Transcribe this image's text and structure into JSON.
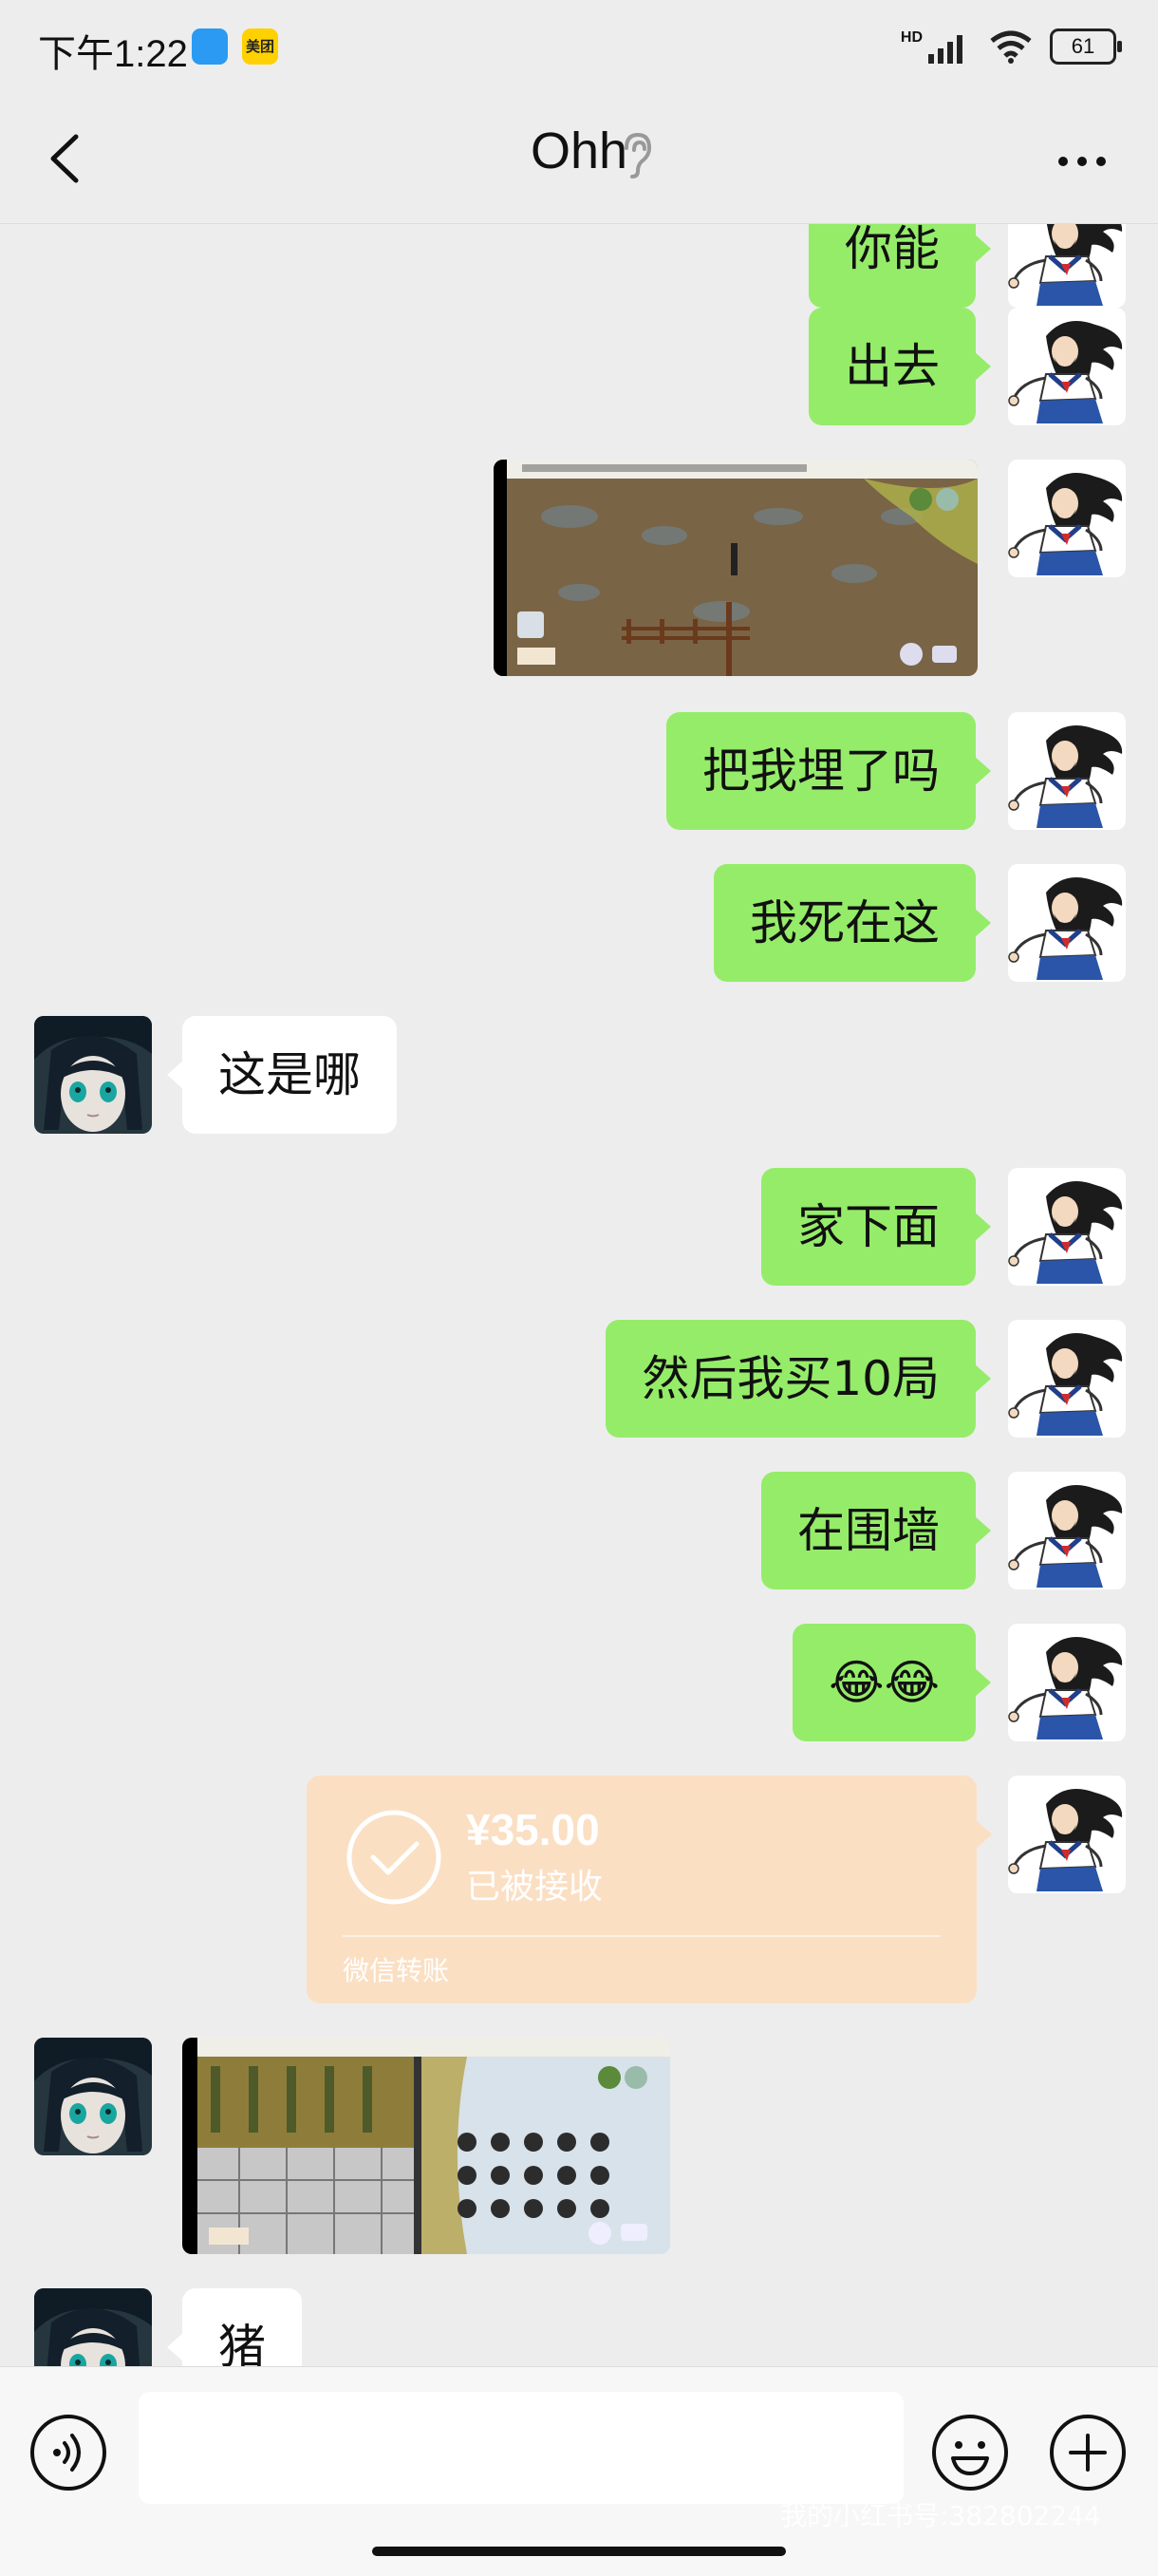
{
  "status_bar": {
    "time": "下午1:22",
    "meituan_badge": "美团",
    "network": "HD",
    "battery": "61"
  },
  "header": {
    "title": "Ohh"
  },
  "messages": [
    {
      "side": "right",
      "type": "text",
      "text": "你能"
    },
    {
      "side": "right",
      "type": "text",
      "text": "出去"
    },
    {
      "side": "right",
      "type": "image"
    },
    {
      "side": "right",
      "type": "text",
      "text": "把我埋了吗"
    },
    {
      "side": "right",
      "type": "text",
      "text": "我死在这"
    },
    {
      "side": "left",
      "type": "text",
      "text": "这是哪"
    },
    {
      "side": "right",
      "type": "text",
      "text": "家下面"
    },
    {
      "side": "right",
      "type": "text",
      "text": "然后我买10局"
    },
    {
      "side": "right",
      "type": "text",
      "text": "在围墙"
    },
    {
      "side": "right",
      "type": "text",
      "text": "😂😂"
    },
    {
      "side": "right",
      "type": "transfer"
    },
    {
      "side": "left",
      "type": "image"
    },
    {
      "side": "left",
      "type": "text",
      "text": "猪"
    }
  ],
  "transfer": {
    "amount": "¥35.00",
    "status": "已被接收",
    "label": "微信转账"
  },
  "input": {
    "value": "",
    "placeholder": ""
  },
  "watermark": "我的小红书号:382802244",
  "colors": {
    "background": "#ededed",
    "bubble_sent": "#95ec69",
    "bubble_received": "#ffffff",
    "transfer_accepted": "#fbdfc3"
  }
}
